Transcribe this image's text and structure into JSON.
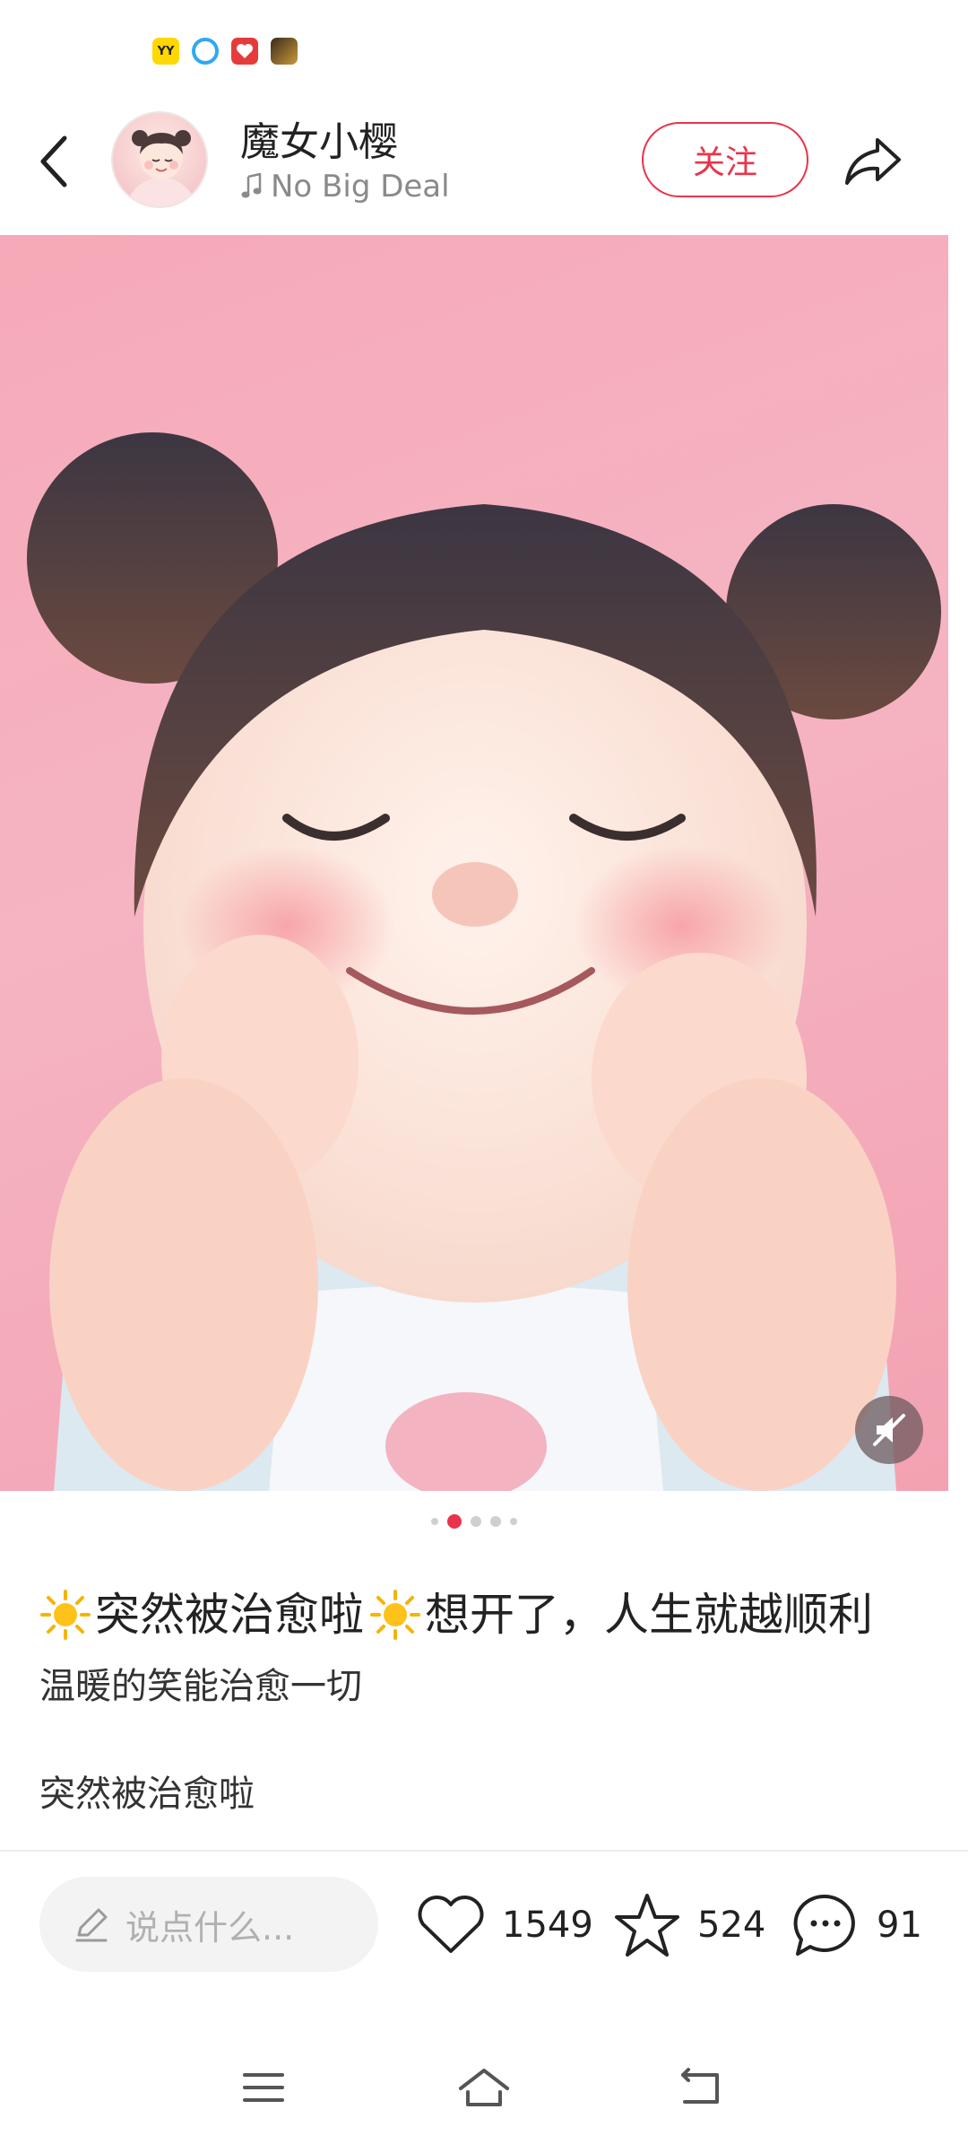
{
  "status_bar": {
    "icons": [
      {
        "name": "yy-app-icon",
        "text": "YY"
      },
      {
        "name": "bird-app-icon",
        "text": ""
      },
      {
        "name": "red-app-icon",
        "text": ""
      },
      {
        "name": "game-app-icon",
        "text": ""
      }
    ]
  },
  "header": {
    "author_name": "魔女小樱",
    "music_title": "No Big Deal",
    "follow_label": "关注"
  },
  "carousel": {
    "total": 5,
    "active_index": 1
  },
  "caption": {
    "title_part1": "突然被治愈啦",
    "title_part2": "想开了，人生就越顺利",
    "subtitle": "温暖的笑能治愈一切",
    "body": "突然被治愈啦"
  },
  "actions": {
    "comment_placeholder": "说点什么...",
    "likes": "1549",
    "favorites": "524",
    "comments": "91"
  },
  "colors": {
    "accent": "#e8344b",
    "image_bg": "#f5b0be"
  }
}
